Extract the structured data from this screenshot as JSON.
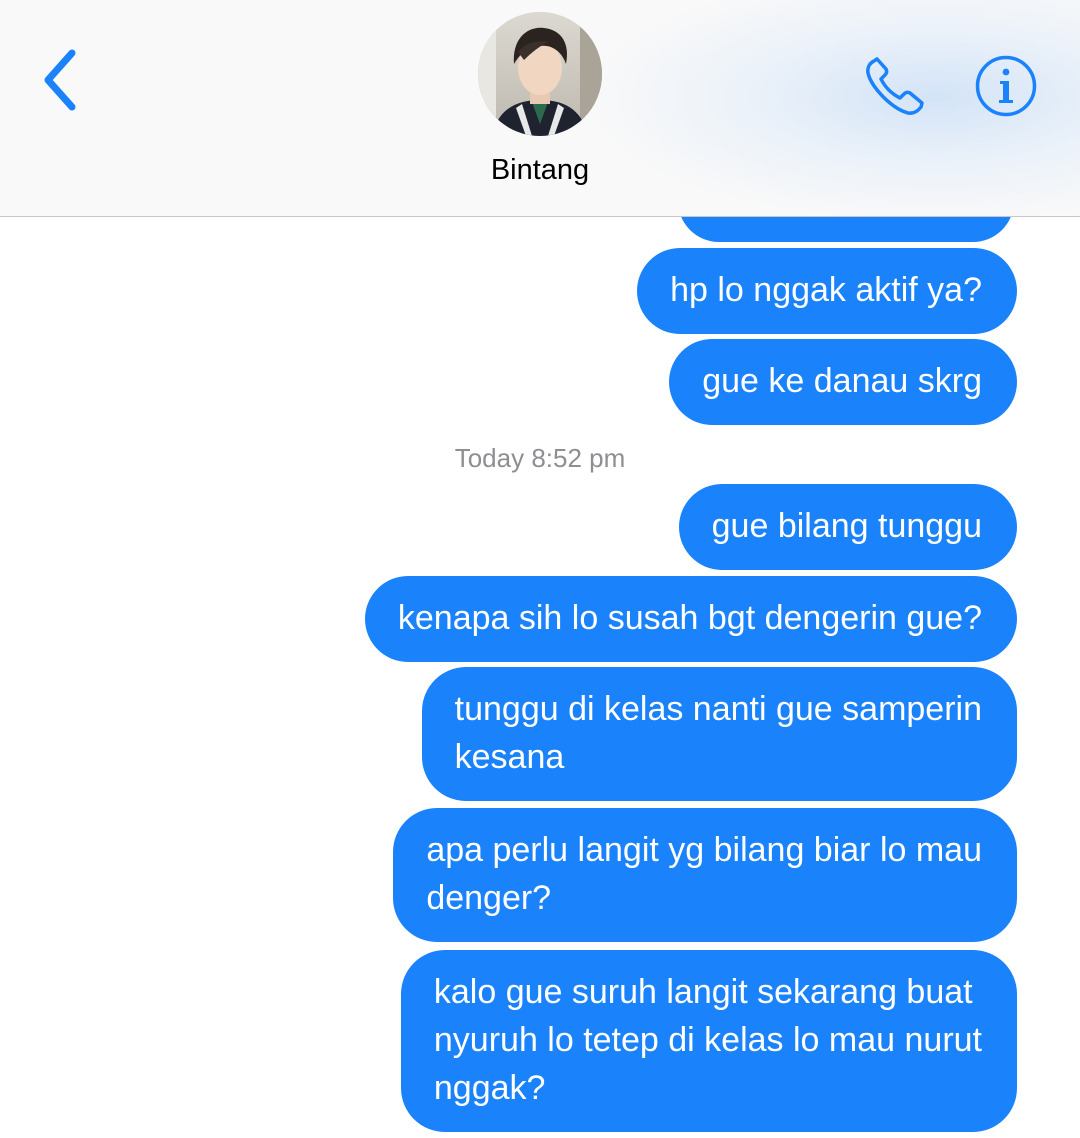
{
  "header": {
    "contact_name": "Bintang",
    "back_icon": "chevron-left-icon",
    "call_icon": "phone-icon",
    "info_icon": "info-icon",
    "accent_color": "#1a82fb"
  },
  "messages_before": [
    {
      "text": "hp lo nggak aktif ya?"
    },
    {
      "text": "gue ke danau skrg"
    }
  ],
  "timestamp": "Today 8:52 pm",
  "messages_after": [
    {
      "lines": [
        "gue bilang tunggu"
      ]
    },
    {
      "lines": [
        "kenapa sih lo susah bgt dengerin gue?"
      ]
    },
    {
      "lines": [
        "tunggu di kelas nanti gue samperin",
        "kesana"
      ]
    },
    {
      "lines": [
        "apa perlu langit yg bilang biar lo mau",
        "denger?"
      ]
    },
    {
      "lines": [
        "kalo gue suruh langit sekarang buat",
        "nyuruh lo tetep di kelas lo mau nurut",
        "nggak?"
      ]
    }
  ]
}
